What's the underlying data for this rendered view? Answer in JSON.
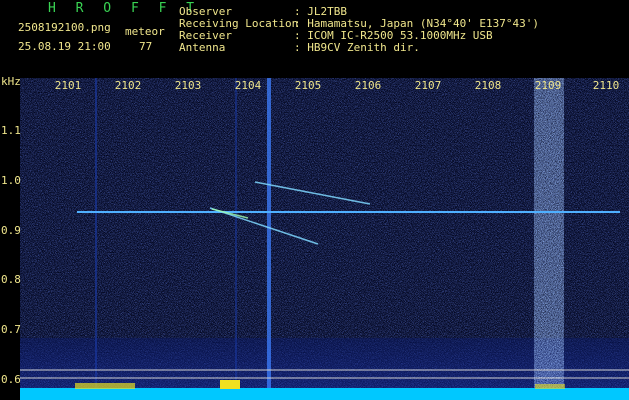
{
  "header": {
    "app_title": "H R O F F T",
    "filename": "2508192100.png",
    "datetime": "25.08.19 21:00",
    "mode_label": "meteor",
    "count": "77",
    "fields": [
      {
        "label": "Observer",
        "value": ": JL2TBB"
      },
      {
        "label": "Receiving Location",
        "value": ": Hamamatsu, Japan (N34°40' E137°43')"
      },
      {
        "label": "Receiver",
        "value": ": ICOM IC-R2500 53.1000MHz USB"
      },
      {
        "label": "Antenna",
        "value": ": HB9CV Zenith dir."
      }
    ]
  },
  "axes": {
    "y_unit": "kHz",
    "x_ticks": [
      "2101",
      "2102",
      "2103",
      "2104",
      "2105",
      "2106",
      "2107",
      "2108",
      "2109",
      "2110"
    ],
    "y_ticks": [
      "1.1",
      "1.0",
      "0.9",
      "0.8",
      "0.7",
      "0.6"
    ]
  },
  "colors": {
    "background": "#000000",
    "label": "#f0e68c",
    "title": "#39d353",
    "spectrum_bg": "#02061f",
    "carrier": "#4fb0ff",
    "meteor": "#7fd8ff"
  }
}
